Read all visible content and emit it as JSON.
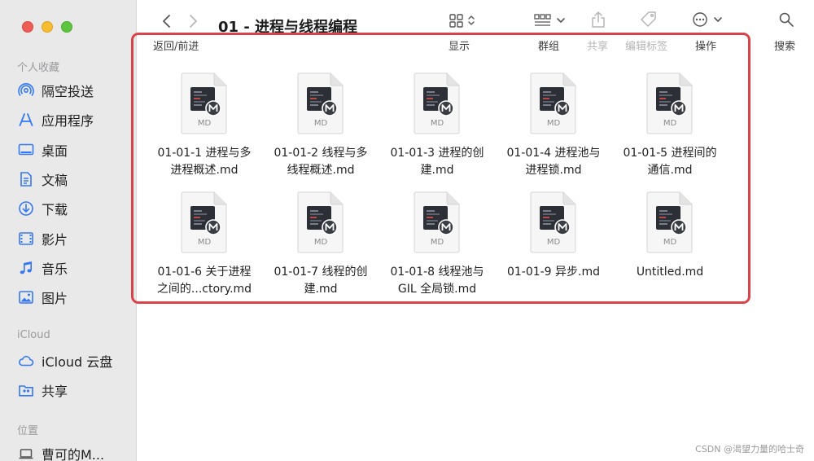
{
  "window": {
    "title": "01 - 进程与线程编程"
  },
  "sidebar": {
    "favorites_title": "个人收藏",
    "favorites": [
      {
        "label": "隔空投送",
        "icon": "airdrop-icon"
      },
      {
        "label": "应用程序",
        "icon": "applications-icon"
      },
      {
        "label": "桌面",
        "icon": "desktop-icon"
      },
      {
        "label": "文稿",
        "icon": "documents-icon"
      },
      {
        "label": "下载",
        "icon": "downloads-icon"
      },
      {
        "label": "影片",
        "icon": "movies-icon"
      },
      {
        "label": "音乐",
        "icon": "music-icon"
      },
      {
        "label": "图片",
        "icon": "pictures-icon"
      }
    ],
    "icloud_title": "iCloud",
    "icloud": [
      {
        "label": "iCloud 云盘",
        "icon": "cloud-icon"
      },
      {
        "label": "共享",
        "icon": "shared-folder-icon"
      }
    ],
    "locations_title": "位置",
    "locations": [
      {
        "label": "曹可的M...",
        "icon": "laptop-icon"
      }
    ]
  },
  "toolbar": {
    "back_forward": "返回/前进",
    "view": "显示",
    "group": "群组",
    "share": "共享",
    "edit_tags": "编辑标签",
    "action": "操作",
    "search": "搜索"
  },
  "files": [
    {
      "name": "01-01-1 进程与多\n进程概述.md",
      "type": "MD"
    },
    {
      "name": "01-01-2 线程与多\n线程概述.md",
      "type": "MD"
    },
    {
      "name": "01-01-3 进程的创\n建.md",
      "type": "MD"
    },
    {
      "name": "01-01-4 进程池与\n进程锁.md",
      "type": "MD"
    },
    {
      "name": "01-01-5 进程间的\n通信.md",
      "type": "MD"
    },
    {
      "name": "01-01-6 关于进程\n之间的...ctory.md",
      "type": "MD"
    },
    {
      "name": "01-01-7 线程的创\n建.md",
      "type": "MD"
    },
    {
      "name": "01-01-8 线程池与\nGIL 全局锁.md",
      "type": "MD"
    },
    {
      "name": "01-01-9 异步.md",
      "type": "MD"
    },
    {
      "name": "Untitled.md",
      "type": "MD"
    }
  ],
  "watermark": "CSDN @渴望力量的哈士奇",
  "colors": {
    "highlight": "#d9434a",
    "sidebar_icon": "#3478f6"
  }
}
